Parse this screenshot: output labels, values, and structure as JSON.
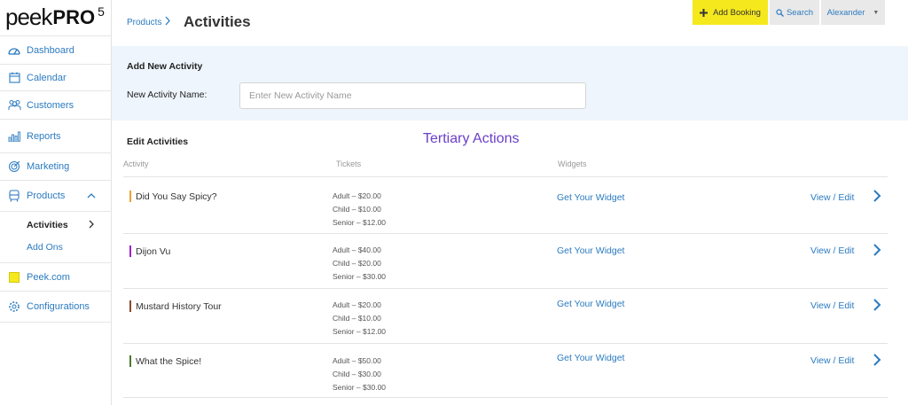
{
  "logo": {
    "peek": "peek",
    "pro": "PRO",
    "version": "5"
  },
  "sidebar": {
    "items": [
      {
        "label": "Dashboard",
        "icon": "dashboard-icon"
      },
      {
        "label": "Calendar",
        "icon": "calendar-icon"
      },
      {
        "label": "Customers",
        "icon": "customers-icon"
      },
      {
        "label": "Reports",
        "icon": "reports-icon"
      },
      {
        "label": "Marketing",
        "icon": "marketing-icon"
      },
      {
        "label": "Products",
        "icon": "products-icon"
      },
      {
        "label": "Peek.com",
        "icon": "peek-com-icon"
      },
      {
        "label": "Configurations",
        "icon": "gear-icon"
      }
    ],
    "sub_items": [
      {
        "label": "Activities",
        "active": true
      },
      {
        "label": "Add Ons",
        "active": false
      }
    ]
  },
  "header": {
    "breadcrumb": "Products",
    "title": "Activities",
    "add_booking_label": "Add Booking",
    "search_label": "Search",
    "user_name": "Alexander"
  },
  "add_activity": {
    "title": "Add New Activity",
    "name_label": "New Activity Name:",
    "name_placeholder": "Enter New Activity Name",
    "name_value": ""
  },
  "edit_activities": {
    "title": "Edit Activities",
    "annotation": "Tertiary Actions",
    "columns": {
      "activity": "Activity",
      "tickets": "Tickets",
      "widgets": "Widgets"
    },
    "rows": [
      {
        "name": "Did You Say Spicy?",
        "color": "#f0a030",
        "tickets": [
          "Adult – $20.00",
          "Child – $10.00",
          "Senior – $12.00"
        ],
        "widget": "Get Your Widget",
        "action": "View / Edit"
      },
      {
        "name": "Dijon Vu",
        "color": "#a020c8",
        "tickets": [
          "Adult – $40.00",
          "Child – $20.00",
          "Senior – $30.00"
        ],
        "widget": "Get Your Widget",
        "action": "View / Edit"
      },
      {
        "name": "Mustard History Tour",
        "color": "#8b4a2a",
        "tickets": [
          "Adult – $20.00",
          "Child – $10.00",
          "Senior – $12.00"
        ],
        "widget": "Get Your Widget",
        "action": "View / Edit"
      },
      {
        "name": "What the Spice!",
        "color": "#4a7a2a",
        "tickets": [
          "Adult – $50.00",
          "Child – $30.00",
          "Senior – $30.00"
        ],
        "widget": "Get Your Widget",
        "action": "View / Edit"
      }
    ]
  },
  "colors": {
    "accent_blue": "#2b7bc0",
    "add_booking_yellow": "#f5e81d",
    "panel_bg": "#eef5fc",
    "annotation_purple": "#6b3fc8"
  }
}
